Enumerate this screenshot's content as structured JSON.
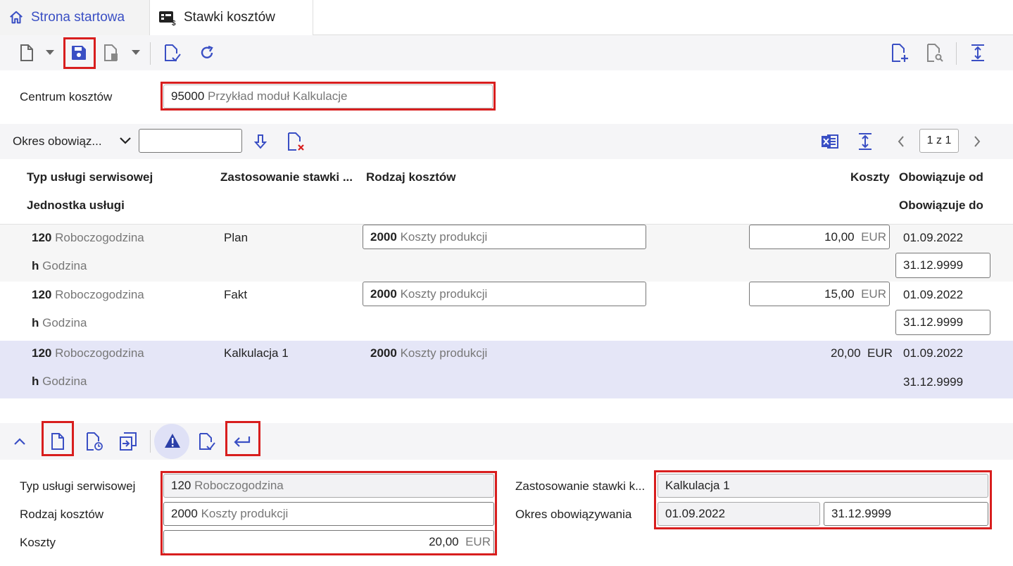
{
  "tabs": [
    {
      "label": "Strona startowa",
      "icon": "home-icon"
    },
    {
      "label": "Stawki kosztów",
      "icon": "cost-rates-icon"
    }
  ],
  "header": {
    "cost_center_label": "Centrum kosztów",
    "cost_center_code": "95000",
    "cost_center_name": "Przykład moduł Kalkulacje"
  },
  "filter": {
    "period_label": "Okres obowiąz...",
    "period_value": "",
    "pager": "1 z 1"
  },
  "table": {
    "headers": {
      "service_type": "Typ usługi serwisowej",
      "service_unit": "Jednostka usługi",
      "rate_usage": "Zastosowanie stawki ...",
      "cost_type": "Rodzaj kosztów",
      "costs": "Koszty",
      "valid_from": "Obowiązuje od",
      "valid_to": "Obowiązuje do"
    },
    "rows": [
      {
        "st_code": "120",
        "st_name": "Roboczogodzina",
        "unit_code": "h",
        "unit_name": "Godzina",
        "usage": "Plan",
        "ct_code": "2000",
        "ct_name": "Koszty produkcji",
        "cost": "10,00",
        "currency": "EUR",
        "from": "01.09.2022",
        "to": "31.12.9999"
      },
      {
        "st_code": "120",
        "st_name": "Roboczogodzina",
        "unit_code": "h",
        "unit_name": "Godzina",
        "usage": "Fakt",
        "ct_code": "2000",
        "ct_name": "Koszty produkcji",
        "cost": "15,00",
        "currency": "EUR",
        "from": "01.09.2022",
        "to": "31.12.9999"
      },
      {
        "st_code": "120",
        "st_name": "Roboczogodzina",
        "unit_code": "h",
        "unit_name": "Godzina",
        "usage": "Kalkulacja 1",
        "ct_code": "2000",
        "ct_name": "Koszty produkcji",
        "cost": "20,00",
        "currency": "EUR",
        "from": "01.09.2022",
        "to": "31.12.9999"
      }
    ]
  },
  "detail": {
    "service_type_label": "Typ usługi serwisowej",
    "service_type_code": "120",
    "service_type_name": "Roboczogodzina",
    "cost_type_label": "Rodzaj kosztów",
    "cost_type_code": "2000",
    "cost_type_name": "Koszty produkcji",
    "costs_label": "Koszty",
    "costs_value": "20,00",
    "costs_currency": "EUR",
    "usage_label": "Zastosowanie stawki k...",
    "usage_value": "Kalkulacja 1",
    "period_label": "Okres obowiązywania",
    "period_from": "01.09.2022",
    "period_to": "31.12.9999"
  },
  "colors": {
    "accent": "#3a4fc4",
    "highlight": "#d81e1e",
    "selected_row": "#e5e6f7"
  }
}
